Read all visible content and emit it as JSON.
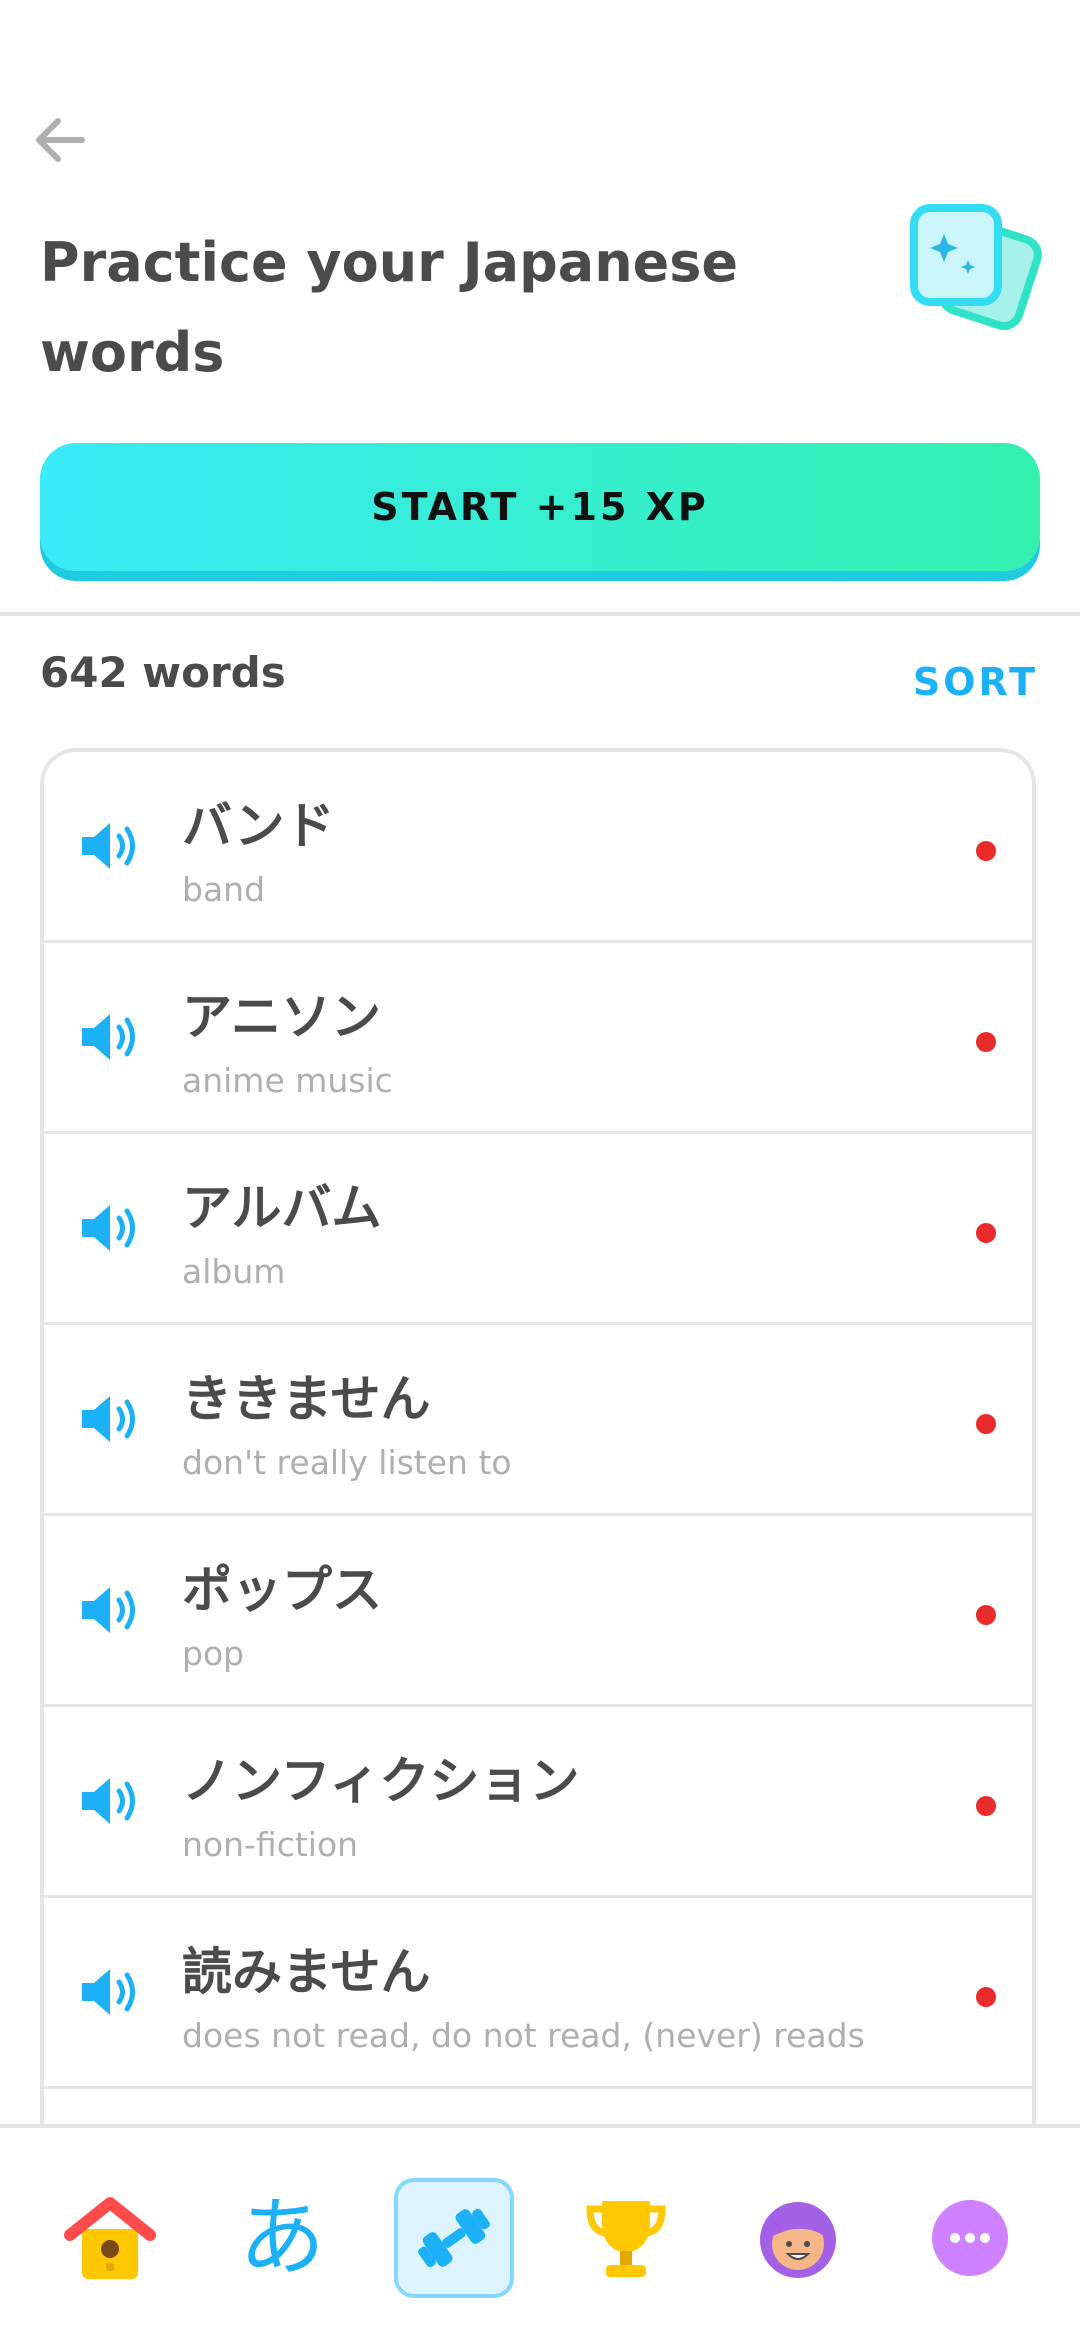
{
  "header": {
    "back_icon": "arrow-left-icon",
    "title": "Practice your Japanese words",
    "practice_icon": "sparkle-cards-icon"
  },
  "start_button": {
    "label": "START +15 XP"
  },
  "words_section": {
    "count_label": "642 words",
    "sort_label": "SORT",
    "items": [
      {
        "word": "バンド",
        "meaning": "band"
      },
      {
        "word": "アニソン",
        "meaning": "anime music"
      },
      {
        "word": "アルバム",
        "meaning": "album"
      },
      {
        "word": "ききません",
        "meaning": "don't really listen to"
      },
      {
        "word": "ポップス",
        "meaning": "pop"
      },
      {
        "word": "ノンフィクション",
        "meaning": "non-fiction"
      },
      {
        "word": "読みません",
        "meaning": "does not read, do not read, (never) reads"
      }
    ]
  },
  "bottom_nav": {
    "items": [
      {
        "name": "home",
        "icon": "birdhouse-icon"
      },
      {
        "name": "characters",
        "icon": "hiragana-icon",
        "glyph": "あ"
      },
      {
        "name": "practice",
        "icon": "dumbbell-icon",
        "selected": true
      },
      {
        "name": "leaderboards",
        "icon": "trophy-icon"
      },
      {
        "name": "profile",
        "icon": "avatar-icon"
      },
      {
        "name": "more",
        "icon": "more-icon"
      }
    ]
  },
  "colors": {
    "accent_blue": "#1cb0f6",
    "dot_red": "#ea2b2b",
    "text_dark": "#4b4b4b",
    "text_muted": "#afafaf",
    "button_gradient_start": "#3aeaf8",
    "button_gradient_end": "#33f0ae"
  }
}
